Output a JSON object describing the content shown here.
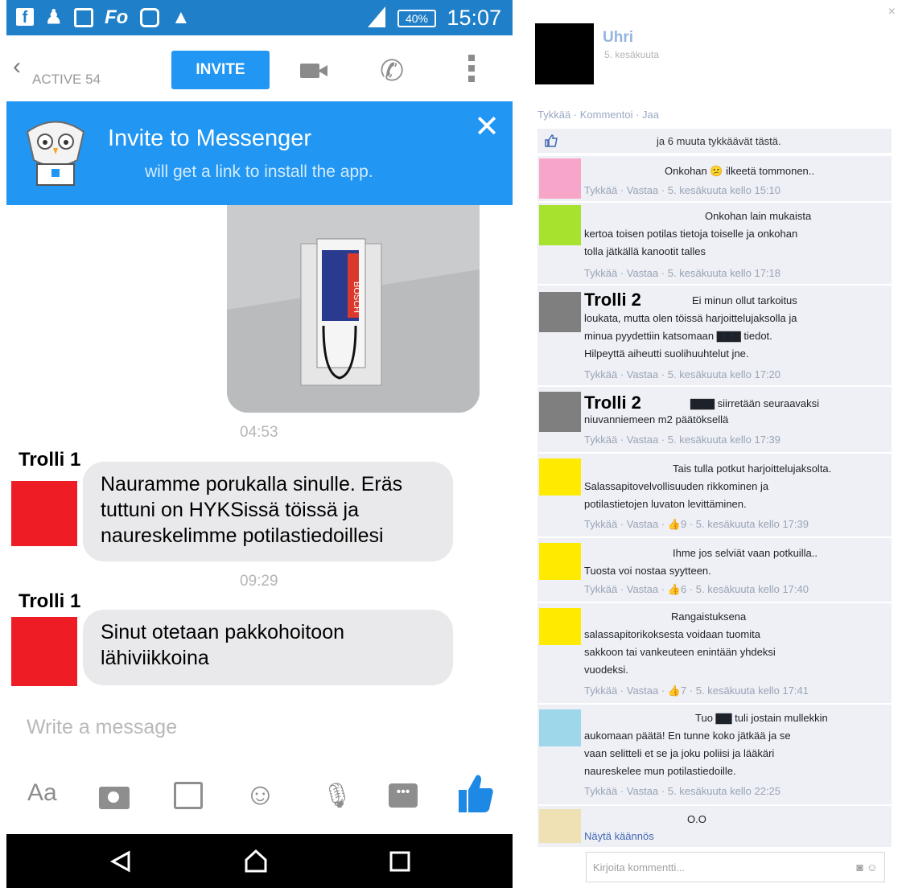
{
  "messenger": {
    "status_time": "15:07",
    "battery": "40%",
    "status_icons": [
      "facebook-icon",
      "add-friend-icon",
      "calendar-icon",
      "fo-icon",
      "instagram-icon",
      "warning-icon"
    ],
    "status_fo_text": "Fo",
    "active_label": "ACTIVE 54",
    "invite_label": "INVITE",
    "banner_title": "Invite to Messenger",
    "banner_subtitle": "will get a link to install the app.",
    "messages": [
      {
        "time": "04:53",
        "sender": "Trolli 1",
        "lines": [
          "Nauramme porukalla sinulle. Eräs",
          "tuttuni on HYKSissä töissä ja",
          "naureskelimme potilastiedoillesi"
        ]
      },
      {
        "time": "09:29",
        "sender": "Trolli 1",
        "lines": [
          "Sinut otetaan pakkohoitoon",
          "lähiviikkoina"
        ]
      }
    ],
    "composer_placeholder": "Write a message",
    "aa_label": "Aa",
    "photo_brand": "BOSCH",
    "colors": {
      "accent": "#2196f3",
      "statusbar": "#1f7fc8",
      "redact": "#ee1c25"
    }
  },
  "facebook": {
    "post_name": "Uhri",
    "post_date": "5. kesäkuuta",
    "actions": "Tykkää · Kommentoi · Jaa",
    "likes_text": "ja 6 muuta tykkäävät tästä.",
    "comments": [
      {
        "color": "#f7a6c9",
        "lines": [
          "Onkohan 😕 ilkeetä tommonen.."
        ],
        "meta": "Tykkää · Vastaa · 5. kesäkuuta kello 15:10"
      },
      {
        "color": "#a6e22e",
        "lines": [
          "Onkohan lain mukaista",
          "kertoa toisen potilas tietoja toiselle ja onkohan",
          "tolla jätkällä kanootit talles"
        ],
        "meta": "Tykkää · Vastaa · 5. kesäkuuta kello 17:18"
      },
      {
        "color": "#7f7f7f",
        "name": "Trolli 2",
        "lines": [
          "Ei minun ollut tarkoitus",
          "loukata, mutta olen töissä harjoittelujaksolla ja",
          "minua pyydettiin katsomaan ▇▇▇ tiedot.",
          "Hilpeyttä aiheutti suolihuuhtelut jne."
        ],
        "meta": "Tykkää · Vastaa · 5. kesäkuuta kello 17:20"
      },
      {
        "color": "#7f7f7f",
        "name": "Trolli 2",
        "lines": [
          "▇▇▇ siirretään seuraavaksi",
          "niuvanniemeen m2 päätöksellä"
        ],
        "meta": "Tykkää · Vastaa · 5. kesäkuuta kello 17:39"
      },
      {
        "color": "#ffea00",
        "lines": [
          "Tais tulla potkut harjoittelujaksolta.",
          "Salassapitovelvollisuuden rikkominen ja",
          "potilastietojen luvaton levittäminen."
        ],
        "meta": "Tykkää · Vastaa · 👍9 · 5. kesäkuuta kello 17:39"
      },
      {
        "color": "#ffea00",
        "lines": [
          "Ihme jos selviät vaan potkuilla..",
          "Tuosta voi nostaa syytteen."
        ],
        "meta": "Tykkää · Vastaa · 👍6 · 5. kesäkuuta kello 17:40"
      },
      {
        "color": "#ffea00",
        "lines": [
          "Rangaistuksena",
          "salassapitorikoksesta voidaan tuomita",
          "sakkoon tai vankeuteen enintään yhdeksi",
          "vuodeksi."
        ],
        "meta": "Tykkää · Vastaa · 👍7 · 5. kesäkuuta kello 17:41"
      },
      {
        "color": "#9fd7ea",
        "lines": [
          "Tuo ▇▇ tuli jostain mullekkin",
          "aukomaan päätä! En tunne koko jätkää ja se",
          "vaan selitteli et se ja joku poliisi ja lääkäri",
          "naureskelee mun potilastiedoille."
        ],
        "meta": "Tykkää · Vastaa · 5. kesäkuuta kello 22:25"
      },
      {
        "color": "#efe1b3",
        "lines": [
          "O.O"
        ],
        "meta": "Näytä käännös"
      }
    ],
    "comment_placeholder": "Kirjoita kommentti...",
    "close_label": "×"
  }
}
